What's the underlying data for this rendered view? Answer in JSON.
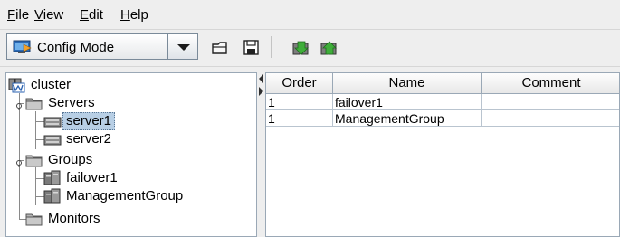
{
  "menu": [
    {
      "mnemonic": "F",
      "rest": "ile"
    },
    {
      "mnemonic": "V",
      "rest": "iew"
    },
    {
      "mnemonic": "E",
      "rest": "dit"
    },
    {
      "mnemonic": "H",
      "rest": "elp"
    }
  ],
  "toolbar": {
    "mode_selected": "Config Mode",
    "buttons": [
      "open-folder-icon",
      "save-disk-icon",
      "download-config-icon",
      "upload-config-icon"
    ]
  },
  "tree": {
    "root": "cluster",
    "servers": "Servers",
    "server1": "server1",
    "server2": "server2",
    "groups": "Groups",
    "group1": "failover1",
    "group2": "ManagementGroup",
    "monitors": "Monitors"
  },
  "table": {
    "columns": [
      "Order",
      "Name",
      "Comment"
    ],
    "rows": [
      {
        "order": "1",
        "name": "failover1",
        "comment": ""
      },
      {
        "order": "1",
        "name": "ManagementGroup",
        "comment": ""
      }
    ]
  },
  "colors": {
    "selection": "#b8cfe5",
    "folder": "#a9a9a9"
  }
}
